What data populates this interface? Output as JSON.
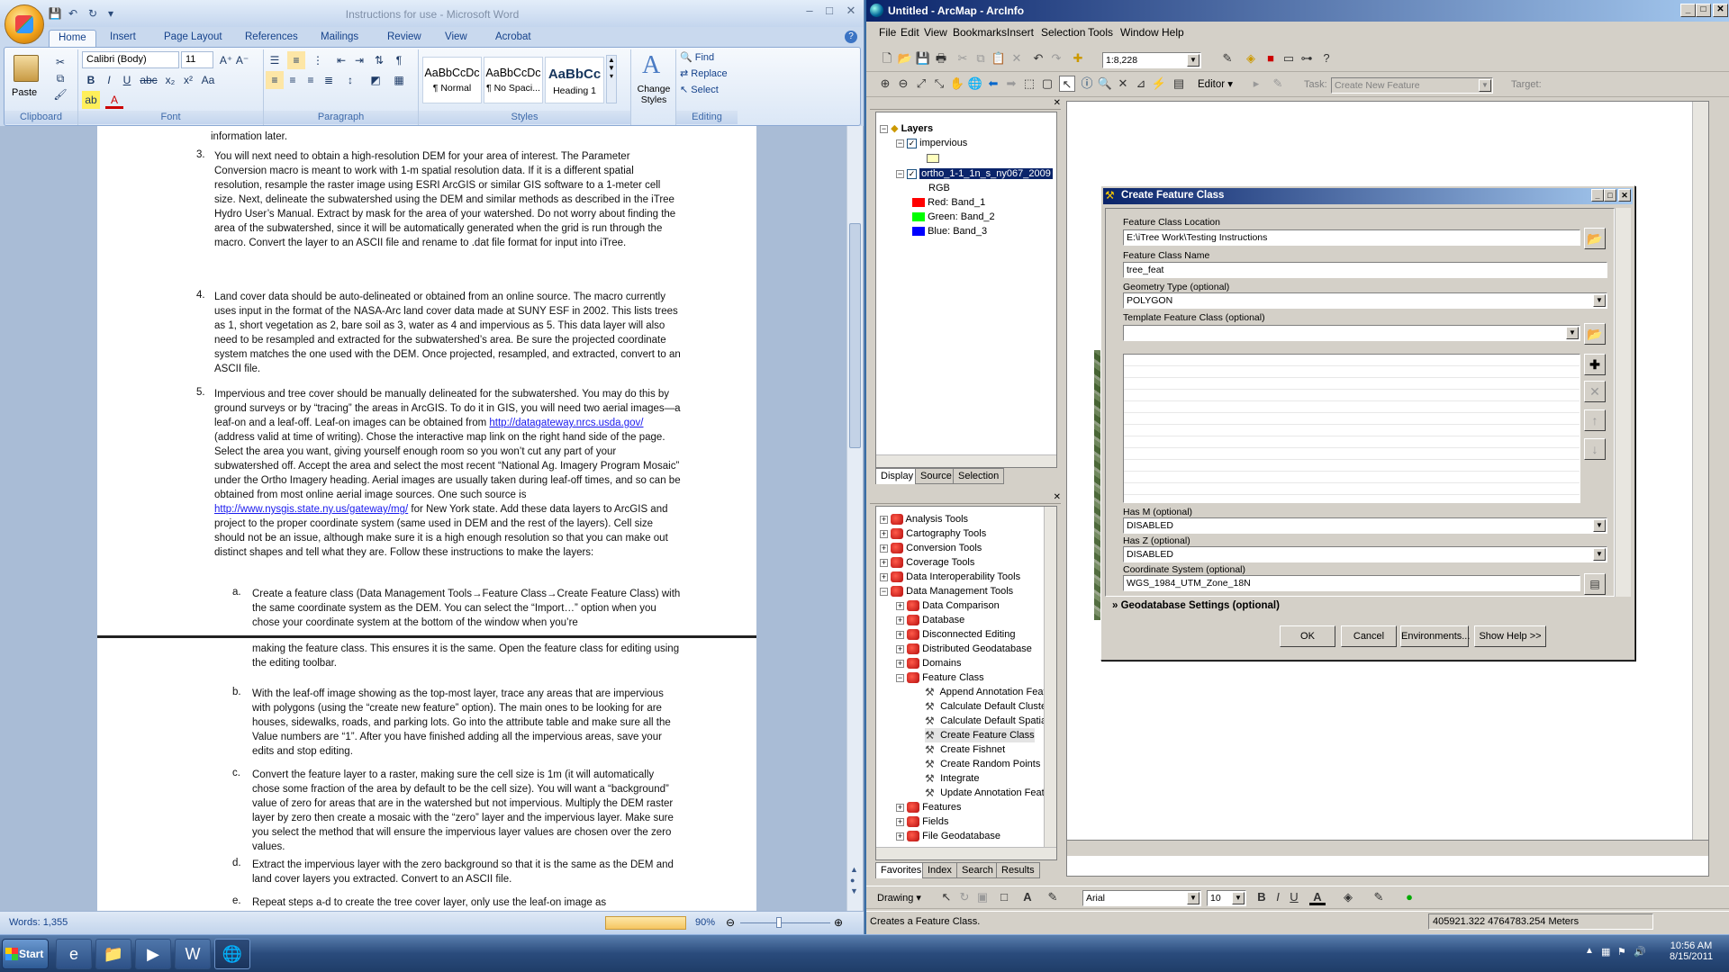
{
  "word": {
    "title": "Instructions for use - Microsoft Word",
    "tabs": [
      "Home",
      "Insert",
      "Page Layout",
      "References",
      "Mailings",
      "Review",
      "View",
      "Acrobat"
    ],
    "clipboard": {
      "paste": "Paste",
      "group": "Clipboard"
    },
    "font": {
      "name": "Calibri (Body)",
      "size": "11",
      "group": "Font"
    },
    "paragraph_group": "Paragraph",
    "styles": [
      {
        "preview": "AaBbCcDc",
        "name": "¶ Normal"
      },
      {
        "preview": "AaBbCcDc",
        "name": "¶ No Spaci..."
      },
      {
        "preview": "AaBbCc",
        "name": "Heading 1"
      }
    ],
    "change_styles": "Change Styles",
    "styles_group": "Styles",
    "editing": {
      "find": "Find",
      "replace": "Replace",
      "select": "Select",
      "group": "Editing"
    },
    "page1": {
      "top_line": "information later.",
      "item3_num": "3.",
      "item3": "You will next need to obtain a high-resolution DEM for your area of interest.  The Parameter Conversion macro is meant to work with 1-m spatial resolution data.  If it is a different spatial resolution, resample the raster image using ESRI ArcGIS or similar GIS software to a 1-meter cell size.  Next, delineate the subwatershed using the DEM and similar methods as described in the iTree Hydro User’s Manual.  Extract by mask for the area of your watershed.  Do not worry about finding the area of the subwatershed, since it will be automatically generated when the grid is run through the macro.  Convert the layer to an ASCII file and rename to .dat file format for input into iTree.",
      "item4_num": "4.",
      "item4": "Land cover data should be auto-delineated or obtained from an online source.  The macro currently uses input in the format of the NASA-Arc land cover data made at SUNY ESF in 2002.  This lists trees as 1, short vegetation as 2, bare soil as 3, water as 4 and impervious as 5.  This data layer will also need to be resampled and extracted for the subwatershed’s area.  Be sure the projected coordinate system matches the one used with the DEM.  Once projected, resampled, and extracted, convert to an ASCII file.",
      "item5_num": "5.",
      "item5_a": "Impervious and tree cover should be manually delineated for the subwatershed.  You may do this by ground surveys or by “tracing” the areas in ArcGIS.  To do it in GIS, you will need two aerial images—a leaf-on and a leaf-off.  Leaf-on images can be obtained from",
      "link1": "http://datagateway.nrcs.usda.gov/",
      "item5_b": " (address valid at time of writing).  Chose the interactive map link on the right hand side of the page.  Select the area you want, giving yourself enough room so you won’t cut any part of your subwatershed off.  Accept the area and select the most recent “National Ag. Imagery Program Mosaic” under the Ortho Imagery heading.  Aerial images are usually taken during leaf-off times, and so can be obtained from most online aerial image sources.  One such source is ",
      "link2": "http://www.nysgis.state.ny.us/gateway/mg/",
      "item5_c": "  for New York state.  Add these data layers to ArcGIS and project to the proper coordinate system (same used in DEM and the rest of the layers).  Cell size should not be an issue, although make sure it is a high enough resolution so that you can make out distinct shapes and tell what they are.  Follow these instructions to make the layers:",
      "suba_num": "a.",
      "suba": "Create a feature class (Data Management Tools→Feature Class→Create Feature Class) with the same coordinate system as the DEM.  You can select the “Import…” option when you chose your coordinate system at the bottom of the window when you’re"
    },
    "page2": {
      "suba_cont": "making the feature class.  This ensures it is the same.   Open the feature class for editing using the editing toolbar.",
      "subb_num": "b.",
      "subb": "With the leaf-off image showing as the top-most layer, trace any areas that are impervious with polygons (using the “create new feature” option).  The main ones to be looking for are houses, sidewalks, roads, and parking lots.  Go into the attribute table and make sure all the Value numbers are “1”.  After you have finished adding all the impervious areas, save your edits and stop editing.",
      "subc_num": "c.",
      "subc": "Convert the feature layer to a raster, making sure the cell size is 1m (it will automatically chose some fraction of the area by default to be the cell size).  You will want a “background” value of zero for areas that are in the watershed but not impervious.  Multiply the DEM raster layer by zero then create a mosaic with the “zero” layer and the impervious layer.  Make sure you select the method that will ensure the impervious layer values are chosen over the zero values.",
      "subd_num": "d.",
      "subd": "Extract the impervious layer with the zero background so that it is the same as the DEM and land cover layers you extracted.  Convert to an ASCII file.",
      "sube_num": "e.",
      "sube": "Repeat steps a-d to create the tree cover layer, only use the leaf-on image as"
    },
    "status": {
      "words": "Words: 1,355",
      "zoom": "90%"
    }
  },
  "arcmap": {
    "title": "Untitled - ArcMap - ArcInfo",
    "menu": [
      "File",
      "Edit",
      "View",
      "Bookmarks",
      "Insert",
      "Selection",
      "Tools",
      "Window",
      "Help"
    ],
    "scale": "1:8,228",
    "editor": "Editor",
    "task_label": "Task:",
    "task_value": "Create New Feature",
    "target_label": "Target:",
    "toc": {
      "root": "Layers",
      "layer1": "impervious",
      "layer2": "ortho_1-1_1n_s_ny067_2009",
      "rgb": "RGB",
      "red": "Red:   Band_1",
      "green": "Green: Band_2",
      "blue": "Blue:  Band_3",
      "colors": {
        "red": "#ff0000",
        "green": "#00ff00",
        "blue": "#0000ff"
      },
      "tabs": [
        "Display",
        "Source",
        "Selection"
      ]
    },
    "toolbox": {
      "items": [
        "Analysis Tools",
        "Cartography Tools",
        "Conversion Tools",
        "Coverage Tools",
        "Data Interoperability Tools",
        "Data Management Tools"
      ],
      "dm_children": [
        "Data Comparison",
        "Database",
        "Disconnected Editing",
        "Distributed Geodatabase",
        "Domains",
        "Feature Class"
      ],
      "fc_children": [
        "Append Annotation Feature Classes",
        "Calculate Default Cluster Tolerance",
        "Calculate Default Spatial Grid Index",
        "Create Feature Class",
        "Create Fishnet",
        "Create Random Points",
        "Integrate",
        "Update Annotation Feature Class"
      ],
      "after": [
        "Features",
        "Fields",
        "File Geodatabase"
      ],
      "tabs": [
        "Favorites",
        "Index",
        "Search",
        "Results"
      ]
    },
    "drawing": {
      "label": "Drawing",
      "font": "Arial",
      "size": "10"
    },
    "status": {
      "message": "Creates a Feature Class.",
      "coords": "405921.322  4764783.254 Meters"
    },
    "dialog": {
      "title": "Create Feature Class",
      "location_label": "Feature Class Location",
      "location": "E:\\iTree Work\\Testing Instructions",
      "name_label": "Feature Class  Name",
      "name": "tree_feat",
      "geom_label": "Geometry Type (optional)",
      "geom": "POLYGON",
      "template_label": "Template Feature Class (optional)",
      "template": "",
      "hasm_label": "Has M (optional)",
      "hasm": "DISABLED",
      "hasz_label": "Has Z (optional)",
      "hasz": "DISABLED",
      "coord_label": "Coordinate System (optional)",
      "coord": "WGS_1984_UTM_Zone_18N",
      "gdb": "Geodatabase Settings (optional)",
      "buttons": [
        "OK",
        "Cancel",
        "Environments...",
        "Show Help >>"
      ]
    }
  },
  "taskbar": {
    "start": "Start",
    "time": "10:56 AM",
    "date": "8/15/2011"
  }
}
